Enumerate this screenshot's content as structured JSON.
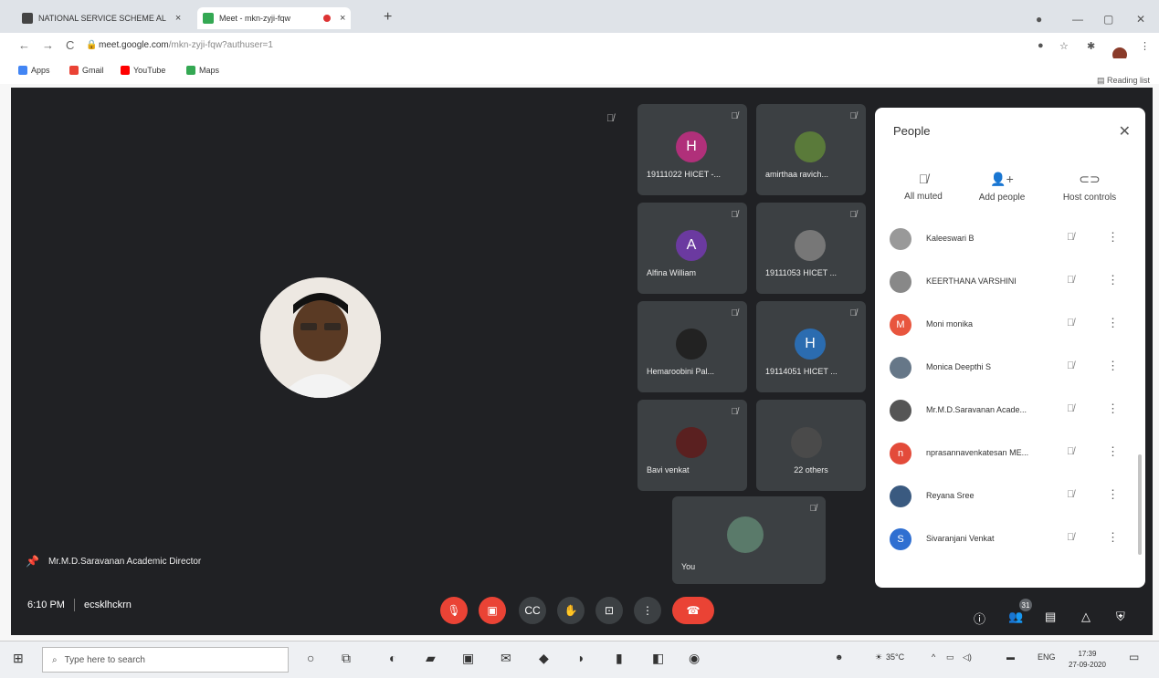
{
  "browser": {
    "tabs": [
      {
        "title": "NATIONAL SERVICE SCHEME AL"
      },
      {
        "title": "Meet - mkn-zyji-fqw"
      }
    ],
    "url_host": "meet.google.com",
    "url_path": "/mkn-zyji-fqw?authuser=1",
    "bookmarks": [
      {
        "label": "Apps"
      },
      {
        "label": "Gmail"
      },
      {
        "label": "YouTube"
      },
      {
        "label": "Maps"
      }
    ],
    "reading_list": "Reading list"
  },
  "meet": {
    "speaker_name": "Mr.M.D.Saravanan Academic Director",
    "time": "6:10 PM",
    "meeting_code": "ecsklhckrn",
    "participant_count": "31",
    "tiles": [
      {
        "name": "19111022 HICET -...",
        "initial": "H",
        "color": "#b0307a"
      },
      {
        "name": "amirthaa ravich...",
        "initial": "",
        "color": "#5a7a3a"
      },
      {
        "name": "Alfina William",
        "initial": "A",
        "color": "#6b3aa0"
      },
      {
        "name": "19111053 HICET ...",
        "initial": "",
        "color": "#777777"
      },
      {
        "name": "Hemaroobini Pal...",
        "initial": "",
        "color": "#222222"
      },
      {
        "name": "19114051 HICET ...",
        "initial": "H",
        "color": "#2b6cb0"
      },
      {
        "name": "Bavi venkat",
        "initial": "",
        "color": "#5a2020"
      },
      {
        "name": "22 others",
        "initial": "",
        "color": "#4a4a4a"
      }
    ],
    "self_tile": "You"
  },
  "people": {
    "title": "People",
    "actions": [
      {
        "label": "All muted"
      },
      {
        "label": "Add people"
      },
      {
        "label": "Host controls"
      }
    ],
    "list": [
      {
        "name": "Kaleeswari B",
        "initial": "",
        "color": "#999999"
      },
      {
        "name": "KEERTHANA VARSHINI",
        "initial": "",
        "color": "#888888"
      },
      {
        "name": "Moni monika",
        "initial": "M",
        "color": "#e8553e"
      },
      {
        "name": "Monica Deepthi S",
        "initial": "",
        "color": "#667788"
      },
      {
        "name": "Mr.M.D.Saravanan Acade...",
        "initial": "",
        "color": "#555555"
      },
      {
        "name": "nprasannavenkatesan ME...",
        "initial": "n",
        "color": "#e34b3a"
      },
      {
        "name": "Reyana Sree",
        "initial": "",
        "color": "#3a5a80"
      },
      {
        "name": "Sivaranjani Venkat",
        "initial": "S",
        "color": "#2f6fd1"
      }
    ]
  },
  "taskbar": {
    "search_placeholder": "Type here to search",
    "temperature": "35°C",
    "language": "ENG",
    "time": "17:39",
    "date": "27-09-2020"
  }
}
